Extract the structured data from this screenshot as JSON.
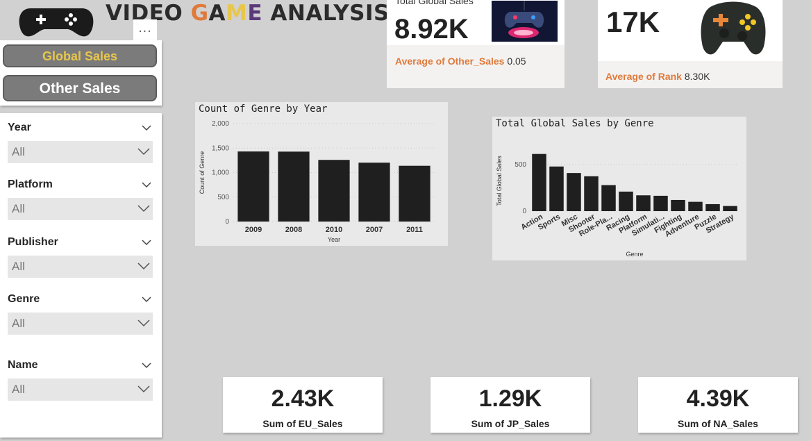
{
  "header": {
    "title_parts": [
      {
        "text": "VIDEO ",
        "color": "#2b2b2b"
      },
      {
        "text": "G",
        "color": "#e07a3a"
      },
      {
        "text": "A",
        "color": "#2b2b2b"
      },
      {
        "text": "M",
        "color": "#e8c64b"
      },
      {
        "text": "E",
        "color": "#5a3a7a"
      },
      {
        "text": " ANALYSIS",
        "color": "#2b2b2b"
      }
    ],
    "more_label": "..."
  },
  "nav": {
    "global_label": "Global Sales",
    "other_label": "Other Sales"
  },
  "slicers": [
    {
      "label": "Year",
      "value": "All"
    },
    {
      "label": "Platform",
      "value": "All"
    },
    {
      "label": "Publisher",
      "value": "All"
    },
    {
      "label": "Genre",
      "value": "All"
    },
    {
      "label": "Name",
      "value": "All"
    }
  ],
  "card1": {
    "label": "Total Global Sales",
    "value": "8.92K",
    "avg_label": "Average of Other_Sales",
    "avg_value": "0.05"
  },
  "card2": {
    "value": "17K",
    "avg_label": "Average of Rank",
    "avg_value": "8.30K"
  },
  "bottom_cards": [
    {
      "value": "2.43K",
      "label": "Sum of EU_Sales"
    },
    {
      "value": "1.29K",
      "label": "Sum of JP_Sales"
    },
    {
      "value": "4.39K",
      "label": "Sum of NA_Sales"
    }
  ],
  "colors": {
    "accent_orange": "#e07a3a",
    "accent_yellow": "#e8c64b",
    "bar": "#1f1f1f"
  },
  "chart_data": [
    {
      "type": "bar",
      "title": "Count of Genre by Year",
      "xlabel": "Year",
      "ylabel": "Count of Genre",
      "categories": [
        "2009",
        "2008",
        "2010",
        "2007",
        "2011"
      ],
      "values": [
        1431,
        1428,
        1259,
        1202,
        1139
      ],
      "ylim": [
        0,
        2000
      ],
      "yticks": [
        "0",
        "500",
        "1,000",
        "1,500",
        "2,000"
      ],
      "ytick_values": [
        0,
        500,
        1000,
        1500,
        2000
      ],
      "grid": true
    },
    {
      "type": "bar",
      "title": "Total Global Sales by Genre",
      "xlabel": "Genre",
      "ylabel": "Total Global Sales",
      "categories": [
        "Action",
        "Sports",
        "Misc",
        "Shooter",
        "Role-Pla...",
        "Racing",
        "Platform",
        "Simulati...",
        "Fighting",
        "Adventure",
        "Puzzle",
        "Strategy"
      ],
      "values": [
        615,
        480,
        410,
        375,
        280,
        210,
        170,
        165,
        120,
        100,
        75,
        55
      ],
      "ylim": [
        0,
        650
      ],
      "yticks": [
        "0",
        "500"
      ],
      "ytick_values": [
        0,
        500
      ],
      "grid": true
    }
  ]
}
